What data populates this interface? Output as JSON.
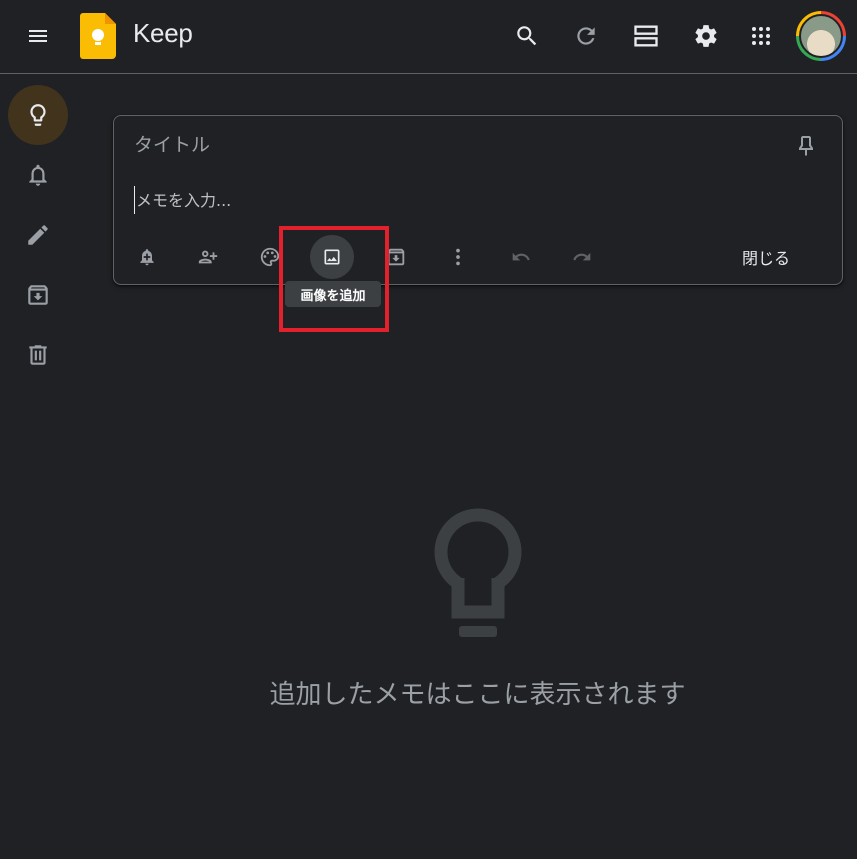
{
  "header": {
    "app_title": "Keep",
    "icons": [
      "menu-icon",
      "keep-logo-icon",
      "search-icon",
      "refresh-icon",
      "list-view-icon",
      "settings-icon",
      "apps-grid-icon"
    ]
  },
  "sidebar": {
    "items": [
      {
        "name": "notes",
        "icon": "lightbulb-icon",
        "active": true
      },
      {
        "name": "reminders",
        "icon": "bell-icon"
      },
      {
        "name": "edit-labels",
        "icon": "pencil-icon"
      },
      {
        "name": "archive",
        "icon": "archive-icon"
      },
      {
        "name": "trash",
        "icon": "trash-icon"
      }
    ]
  },
  "editor": {
    "title_placeholder": "タイトル",
    "body_placeholder": "メモを入力...",
    "close_label": "閉じる",
    "toolbar": [
      "reminder-icon",
      "collaborator-icon",
      "palette-icon",
      "image-icon",
      "archive-icon",
      "more-icon",
      "undo-icon",
      "redo-icon"
    ],
    "tooltip": "画像を追加"
  },
  "empty_state": {
    "message": "追加したメモはここに表示されます"
  },
  "colors": {
    "background": "#202124",
    "border": "#5f6368",
    "active_sidebar": "#41331c",
    "highlight": "#e3212d",
    "logo": "#fbbc04"
  }
}
